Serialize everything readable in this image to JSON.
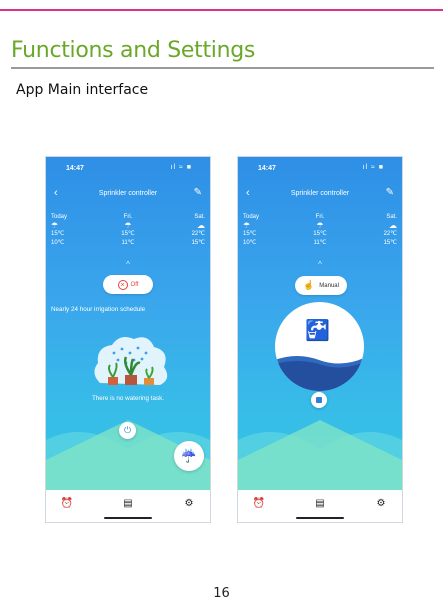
{
  "document": {
    "section_title": "Functions and Settings",
    "subtitle": "App Main interface",
    "page_number": "16"
  },
  "colors": {
    "rule": "#d7348a",
    "title": "#6aa82a",
    "app_blue": "#2e8fe6",
    "off_red": "#e7423a"
  },
  "phones": [
    {
      "status_time": "14:47",
      "nav_title": "Sprinkler controller",
      "weather": [
        {
          "day": "Today",
          "icon": "cloud-rain-icon",
          "high": "15℃",
          "low": "10℃"
        },
        {
          "day": "Fri.",
          "icon": "cloud-rain-icon",
          "high": "15℃",
          "low": "11℃"
        },
        {
          "day": "Sat.",
          "icon": "cloudy-icon",
          "high": "22℃",
          "low": "15℃"
        }
      ],
      "mode_label": "Off",
      "schedule_text": "Nearly 24 hour irrigation schedule",
      "no_task_text": "There is no watering task."
    },
    {
      "status_time": "14:47",
      "nav_title": "Sprinkler controller",
      "weather": [
        {
          "day": "Today",
          "icon": "cloud-rain-icon",
          "high": "15℃",
          "low": "10℃"
        },
        {
          "day": "Fri.",
          "icon": "cloud-rain-icon",
          "high": "15℃",
          "low": "11℃"
        },
        {
          "day": "Sat.",
          "icon": "cloudy-icon",
          "high": "22℃",
          "low": "15℃"
        }
      ],
      "mode_label": "Manual"
    }
  ]
}
